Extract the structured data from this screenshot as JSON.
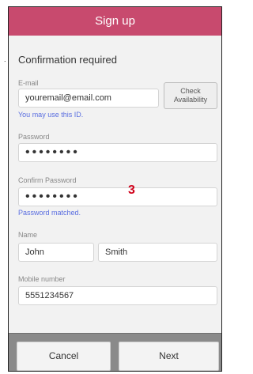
{
  "header": {
    "title": "Sign up"
  },
  "form": {
    "section_title": "Confirmation required",
    "email_label": "E-mail",
    "email_value": "youremail@email.com",
    "check_button": "Check Availability",
    "email_hint": "You may use this ID.",
    "password_label": "Password",
    "password_value": "••••••••",
    "confirm_label": "Confirm Password",
    "confirm_value": "••••••••",
    "confirm_hint": "Password matched.",
    "name_label": "Name",
    "first_name": "John",
    "last_name": "Smith",
    "mobile_label": "Mobile number",
    "mobile_value": "5551234567"
  },
  "annotation": {
    "step": "3"
  },
  "footer": {
    "cancel": "Cancel",
    "next": "Next"
  }
}
